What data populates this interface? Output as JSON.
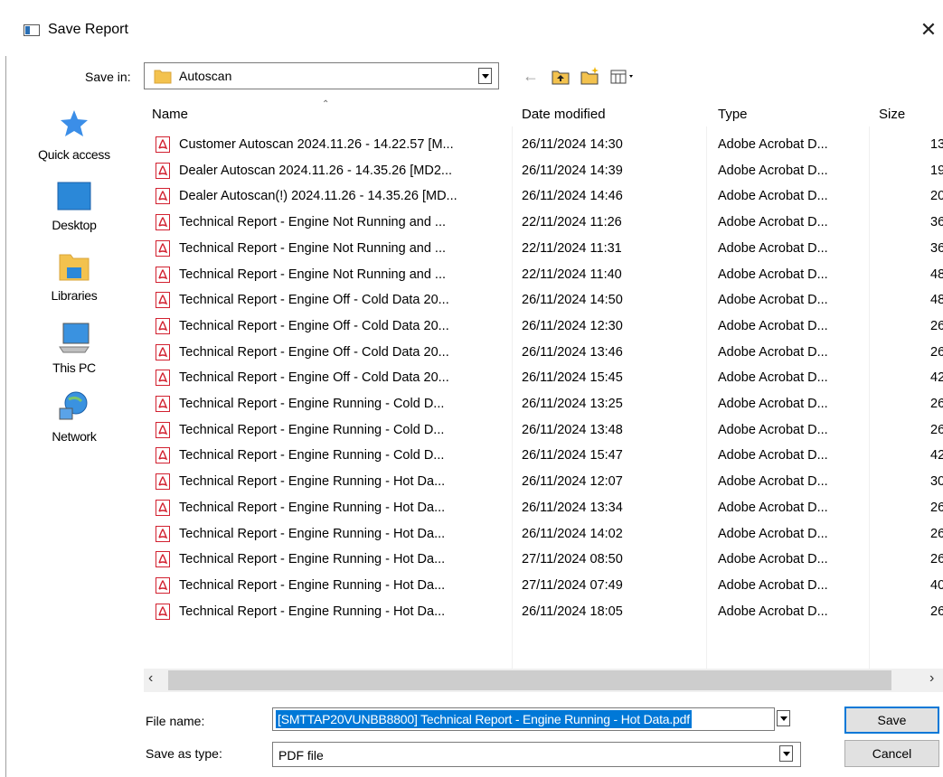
{
  "window": {
    "title": "Save Report",
    "close_label": "✕"
  },
  "toolbar": {
    "save_in_label": "Save in:",
    "save_in_value": "Autoscan",
    "back_icon": "back-arrow-icon",
    "up_icon": "up-folder-icon",
    "new_folder_icon": "new-folder-icon",
    "view_icon": "view-menu-icon"
  },
  "places": [
    {
      "label": "Quick access",
      "icon": "quick-access-icon"
    },
    {
      "label": "Desktop",
      "icon": "desktop-icon"
    },
    {
      "label": "Libraries",
      "icon": "libraries-icon"
    },
    {
      "label": "This PC",
      "icon": "this-pc-icon"
    },
    {
      "label": "Network",
      "icon": "network-icon"
    }
  ],
  "columns": {
    "name": "Name",
    "date": "Date modified",
    "type": "Type",
    "size": "Size"
  },
  "files": [
    {
      "name": "Customer Autoscan 2024.11.26 - 14.22.57 [M...",
      "date": "26/11/2024 14:30",
      "type": "Adobe Acrobat D...",
      "size": "13"
    },
    {
      "name": "Dealer Autoscan 2024.11.26 - 14.35.26 [MD2...",
      "date": "26/11/2024 14:39",
      "type": "Adobe Acrobat D...",
      "size": "19"
    },
    {
      "name": "Dealer Autoscan(!) 2024.11.26 - 14.35.26 [MD...",
      "date": "26/11/2024 14:46",
      "type": "Adobe Acrobat D...",
      "size": "20"
    },
    {
      "name": "Technical Report - Engine Not Running and ...",
      "date": "22/11/2024 11:26",
      "type": "Adobe Acrobat D...",
      "size": "36"
    },
    {
      "name": "Technical Report - Engine Not Running and ...",
      "date": "22/11/2024 11:31",
      "type": "Adobe Acrobat D...",
      "size": "36"
    },
    {
      "name": "Technical Report - Engine Not Running and ...",
      "date": "22/11/2024 11:40",
      "type": "Adobe Acrobat D...",
      "size": "48"
    },
    {
      "name": "Technical Report - Engine Off - Cold Data 20...",
      "date": "26/11/2024 14:50",
      "type": "Adobe Acrobat D...",
      "size": "48"
    },
    {
      "name": "Technical Report - Engine Off - Cold Data 20...",
      "date": "26/11/2024 12:30",
      "type": "Adobe Acrobat D...",
      "size": "26"
    },
    {
      "name": "Technical Report - Engine Off - Cold Data 20...",
      "date": "26/11/2024 13:46",
      "type": "Adobe Acrobat D...",
      "size": "26"
    },
    {
      "name": "Technical Report - Engine Off - Cold Data 20...",
      "date": "26/11/2024 15:45",
      "type": "Adobe Acrobat D...",
      "size": "42"
    },
    {
      "name": "Technical Report - Engine Running - Cold D...",
      "date": "26/11/2024 13:25",
      "type": "Adobe Acrobat D...",
      "size": "26"
    },
    {
      "name": "Technical Report - Engine Running - Cold D...",
      "date": "26/11/2024 13:48",
      "type": "Adobe Acrobat D...",
      "size": "26"
    },
    {
      "name": "Technical Report - Engine Running - Cold D...",
      "date": "26/11/2024 15:47",
      "type": "Adobe Acrobat D...",
      "size": "42"
    },
    {
      "name": "Technical Report - Engine Running - Hot Da...",
      "date": "26/11/2024 12:07",
      "type": "Adobe Acrobat D...",
      "size": "30"
    },
    {
      "name": "Technical Report - Engine Running - Hot Da...",
      "date": "26/11/2024 13:34",
      "type": "Adobe Acrobat D...",
      "size": "26"
    },
    {
      "name": "Technical Report - Engine Running - Hot Da...",
      "date": "26/11/2024 14:02",
      "type": "Adobe Acrobat D...",
      "size": "26"
    },
    {
      "name": "Technical Report - Engine Running - Hot Da...",
      "date": "27/11/2024 08:50",
      "type": "Adobe Acrobat D...",
      "size": "26"
    },
    {
      "name": "Technical Report - Engine Running - Hot Da...",
      "date": "27/11/2024 07:49",
      "type": "Adobe Acrobat D...",
      "size": "40"
    },
    {
      "name": "Technical Report - Engine Running - Hot Da...",
      "date": "26/11/2024 18:05",
      "type": "Adobe Acrobat D...",
      "size": "26"
    }
  ],
  "form": {
    "file_name_label": "File name:",
    "file_name_value": "[SMTTAP20VUNBB8800] Technical Report - Engine Running - Hot Data.pdf",
    "save_as_type_label": "Save as type:",
    "save_as_type_value": "PDF file"
  },
  "buttons": {
    "save": "Save",
    "cancel": "Cancel"
  },
  "colors": {
    "selection": "#0078d7",
    "pdf_red": "#d2202f",
    "folder_yellow": "#f3c24e"
  }
}
